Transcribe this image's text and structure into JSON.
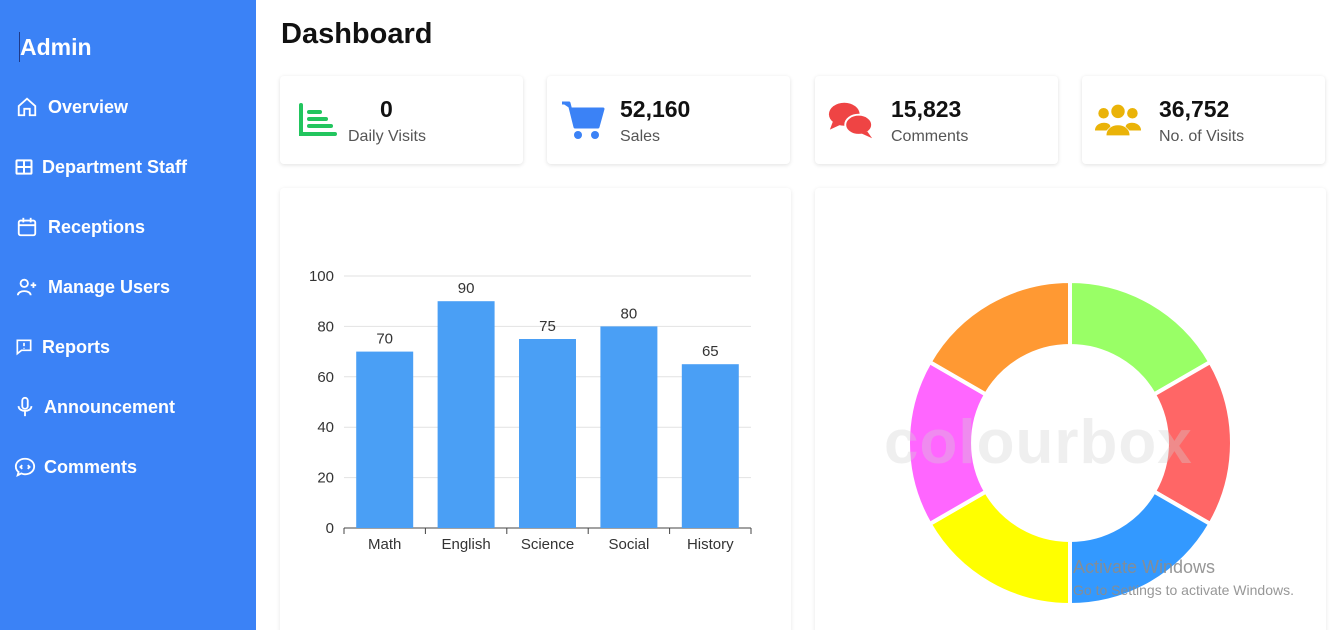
{
  "sidebar": {
    "brand": "Admin",
    "items": [
      {
        "label": "Overview",
        "icon": "home-icon"
      },
      {
        "label": "Department Staff",
        "icon": "grid-icon"
      },
      {
        "label": "Receptions",
        "icon": "calendar-icon"
      },
      {
        "label": "Manage Users",
        "icon": "user-plus-icon"
      },
      {
        "label": "Reports",
        "icon": "report-icon"
      },
      {
        "label": "Announcement",
        "icon": "microphone-icon"
      },
      {
        "label": "Comments",
        "icon": "chat-icon"
      }
    ],
    "bg_color": "#3b82f6"
  },
  "main": {
    "title": "Dashboard",
    "cards": [
      {
        "value": "0",
        "label": "Daily Visits",
        "icon": "bar-list-icon",
        "color": "#22c55e"
      },
      {
        "value": "52,160",
        "label": "Sales",
        "icon": "cart-icon",
        "color": "#3b82f6"
      },
      {
        "value": "15,823",
        "label": "Comments",
        "icon": "comments-icon",
        "color": "#ef4444"
      },
      {
        "value": "36,752",
        "label": "No. of Visits",
        "icon": "users-icon",
        "color": "#eab308"
      }
    ]
  },
  "chart_data": [
    {
      "type": "bar",
      "categories": [
        "Math",
        "English",
        "Science",
        "Social",
        "History"
      ],
      "values": [
        70,
        90,
        75,
        80,
        65
      ],
      "ylim": [
        0,
        100
      ],
      "yticks": [
        0,
        20,
        40,
        60,
        80,
        100
      ],
      "grid": true,
      "bar_color": "#4a9ff5"
    },
    {
      "type": "pie",
      "donut": true,
      "values": [
        1,
        1,
        1,
        1,
        1,
        1
      ],
      "colors": [
        "#99ff66",
        "#ff6666",
        "#3399ff",
        "#ffff00",
        "#ff66ff",
        "#ff9933"
      ]
    }
  ],
  "watermark": "colourbox",
  "os_overlay": {
    "line1": "Activate Windows",
    "line2": "Go to Settings to activate Windows."
  }
}
